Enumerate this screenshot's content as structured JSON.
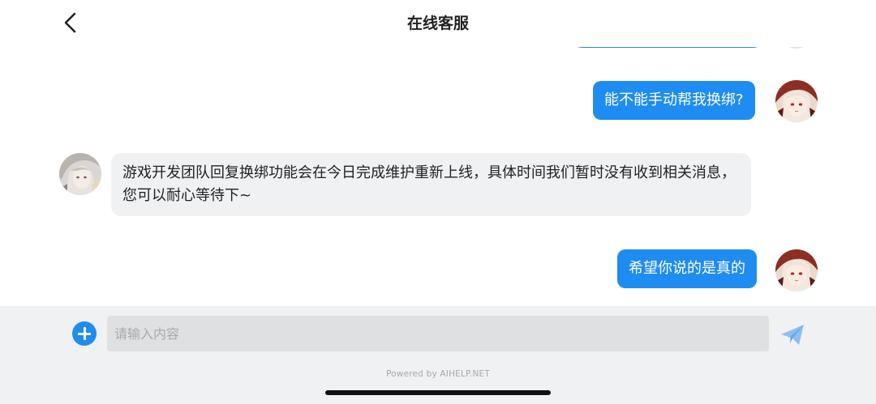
{
  "header": {
    "title": "在线客服",
    "back_icon": "chevron-left-icon"
  },
  "messages": [
    {
      "sender": "user",
      "text": "能不能手动帮我换绑?"
    },
    {
      "sender": "agent",
      "text": "游戏开发团队回复换绑功能会在今日完成维护重新上线，具体时间我们暂时没有收到相关消息，您可以耐心等待下~"
    },
    {
      "sender": "user",
      "text": "希望你说的是真的"
    }
  ],
  "input_bar": {
    "placeholder": "请输入内容",
    "value": "",
    "attach_icon": "plus-circle-icon",
    "send_icon": "paper-plane-icon",
    "powered_by": "Powered by AIHELP.NET"
  },
  "colors": {
    "accent": "#1e8cf0",
    "agent_bubble": "#f0f1f3",
    "input_bar_bg": "#f0f1f3"
  }
}
